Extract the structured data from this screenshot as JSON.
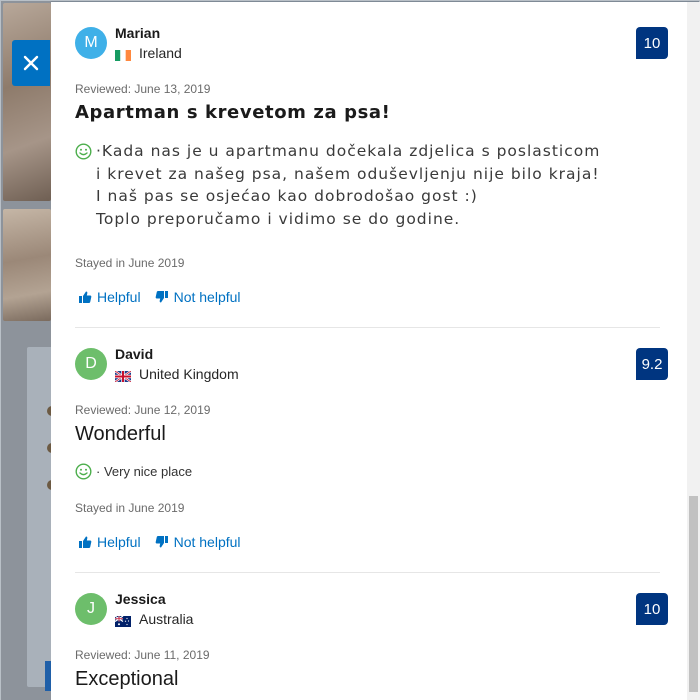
{
  "close_label": "close",
  "reviews": [
    {
      "initial": "M",
      "avatar_color": "#3fb0e8",
      "name": "Marian",
      "country": "Ireland",
      "flag": "ireland-flag",
      "score": "10",
      "reviewed": "Reviewed: June 13, 2019",
      "title": "Apartman s krevetom za psa!",
      "sentiment_icon": "smile-icon",
      "body": "·Kada nas je u apartmanu dočekala zdjelica s poslasticom\ni krevet za našeg psa, našem oduševljenju nije bilo kraja!\nI naš pas se osjećao kao dobrodošao gost :)\nToplo preporučamo i vidimo se do godine.",
      "stayed": "Stayed in June 2019",
      "helpful": "Helpful",
      "not_helpful": "Not helpful"
    },
    {
      "initial": "D",
      "avatar_color": "#6dbe6b",
      "name": "David",
      "country": "United Kingdom",
      "flag": "uk-flag",
      "score": "9.2",
      "reviewed": "Reviewed: June 12, 2019",
      "title": "Wonderful",
      "sentiment_icon": "smile-icon",
      "body": "· Very nice place",
      "stayed": "Stayed in June 2019",
      "helpful": "Helpful",
      "not_helpful": "Not helpful"
    },
    {
      "initial": "J",
      "avatar_color": "#6dbe6b",
      "name": "Jessica",
      "country": "Australia",
      "flag": "australia-flag",
      "score": "10",
      "reviewed": "Reviewed: June 11, 2019",
      "title": "Exceptional"
    }
  ],
  "colors": {
    "accent": "#0071c2",
    "score_badge": "#003580",
    "positive": "#4cae4c"
  }
}
